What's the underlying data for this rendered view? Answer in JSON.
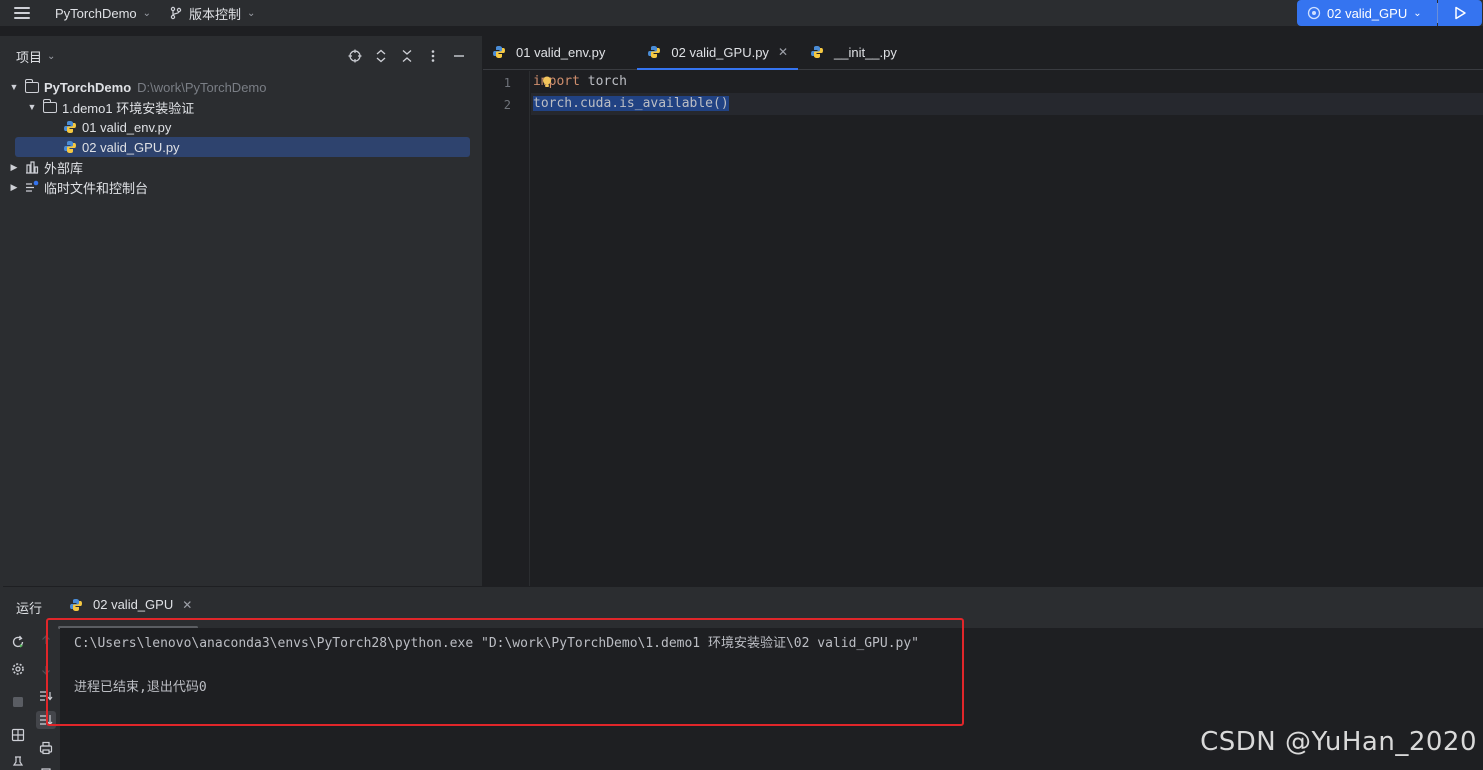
{
  "topbar": {
    "project_name": "PyTorchDemo",
    "vcs_label": "版本控制",
    "run_config": "02 valid_GPU"
  },
  "project_panel": {
    "title": "项目",
    "tree": [
      {
        "label": "PyTorchDemo",
        "hint": "D:\\work\\PyTorchDemo"
      },
      {
        "label": "1.demo1 环境安装验证"
      },
      {
        "label": "01 valid_env.py"
      },
      {
        "label": "02 valid_GPU.py"
      },
      {
        "label": "外部库"
      },
      {
        "label": "临时文件和控制台"
      }
    ]
  },
  "editor": {
    "tabs": [
      {
        "label": "01 valid_env.py"
      },
      {
        "label": "02 valid_GPU.py"
      },
      {
        "label": "__init__.py"
      }
    ],
    "lines": [
      {
        "number": "1",
        "keyword": "import",
        "rest": " torch"
      },
      {
        "number": "2",
        "text": "torch.cuda.is_available()"
      }
    ]
  },
  "run_panel": {
    "title": "运行",
    "tab_label": "02 valid_GPU",
    "output": [
      "C:\\Users\\lenovo\\anaconda3\\envs\\PyTorch28\\python.exe \"D:\\work\\PyTorchDemo\\1.demo1 环境安装验证\\02 valid_GPU.py\"",
      "进程已结束,退出代码0"
    ]
  },
  "watermark": "CSDN @YuHan_2020",
  "colors": {
    "accent": "#3574f0",
    "selection": "#214283",
    "keyword": "#cf8e6d",
    "highlight_box": "#e0262a"
  }
}
